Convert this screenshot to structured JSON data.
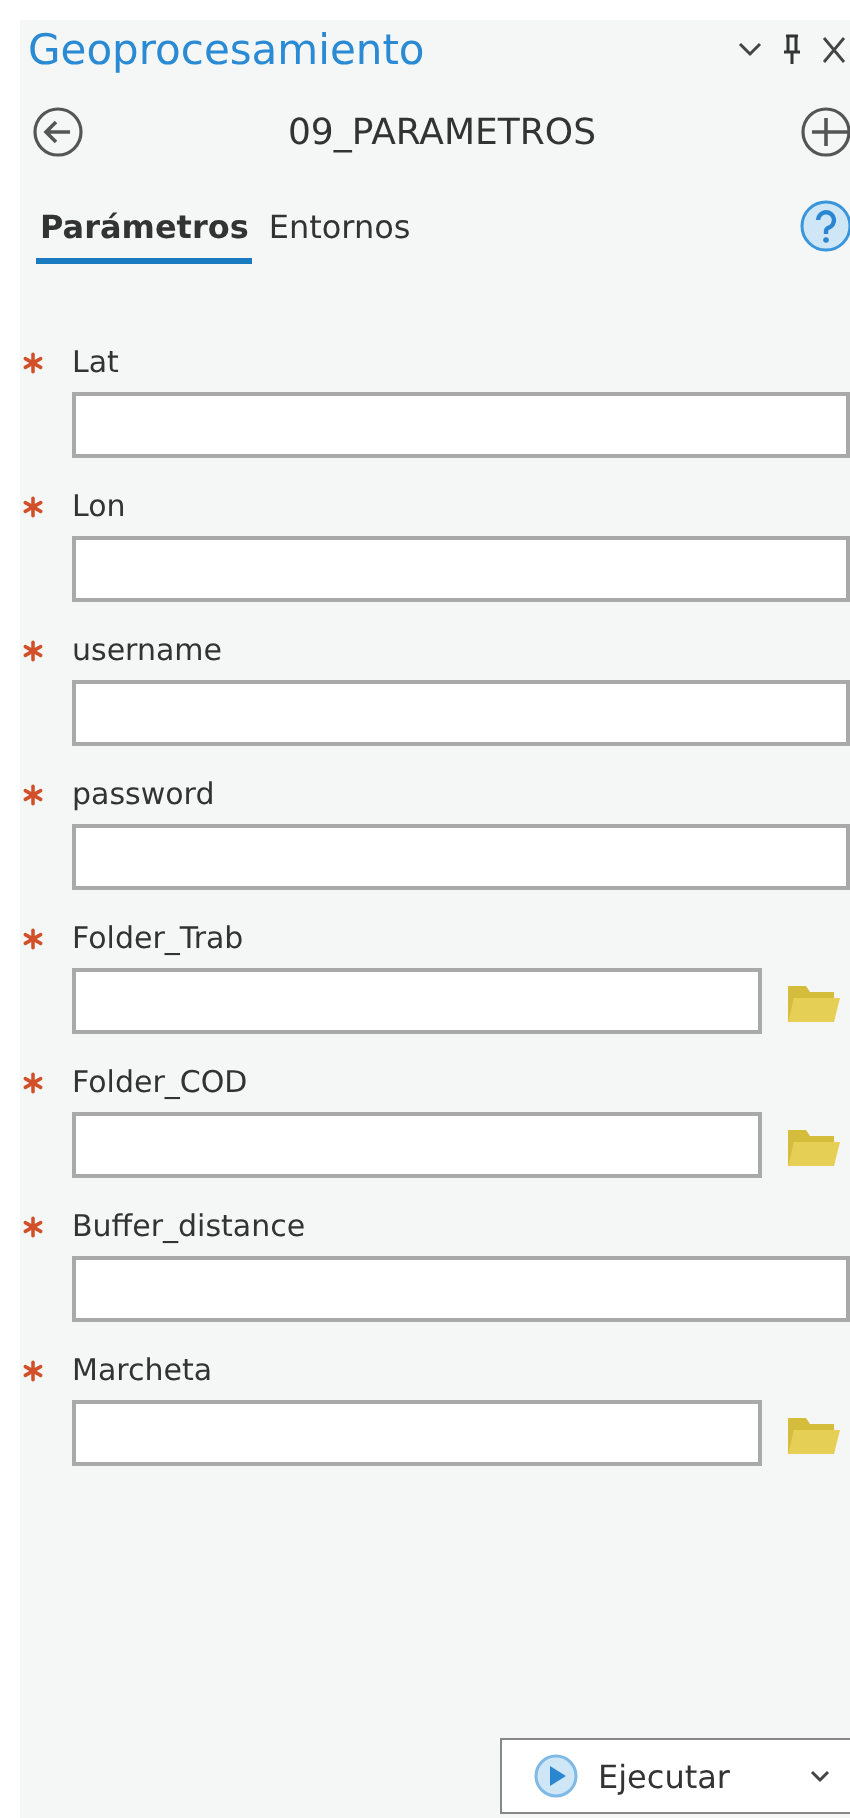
{
  "pane": {
    "title": "Geoprocesamiento"
  },
  "tool": {
    "name": "09_PARAMETROS"
  },
  "tabs": [
    {
      "label": "Parámetros",
      "selected": true
    },
    {
      "label": "Entornos",
      "selected": false
    }
  ],
  "parameters": [
    {
      "label": "Lat",
      "required": true,
      "kind": "text"
    },
    {
      "label": "Lon",
      "required": true,
      "kind": "text"
    },
    {
      "label": "username",
      "required": true,
      "kind": "text"
    },
    {
      "label": "password",
      "required": true,
      "kind": "text"
    },
    {
      "label": "Folder_Trab",
      "required": true,
      "kind": "folder"
    },
    {
      "label": "Folder_COD",
      "required": true,
      "kind": "folder"
    },
    {
      "label": "Buffer_distance",
      "required": true,
      "kind": "text"
    },
    {
      "label": "Marcheta",
      "required": true,
      "kind": "folder"
    }
  ],
  "run_button": {
    "label": "Ejecutar"
  }
}
